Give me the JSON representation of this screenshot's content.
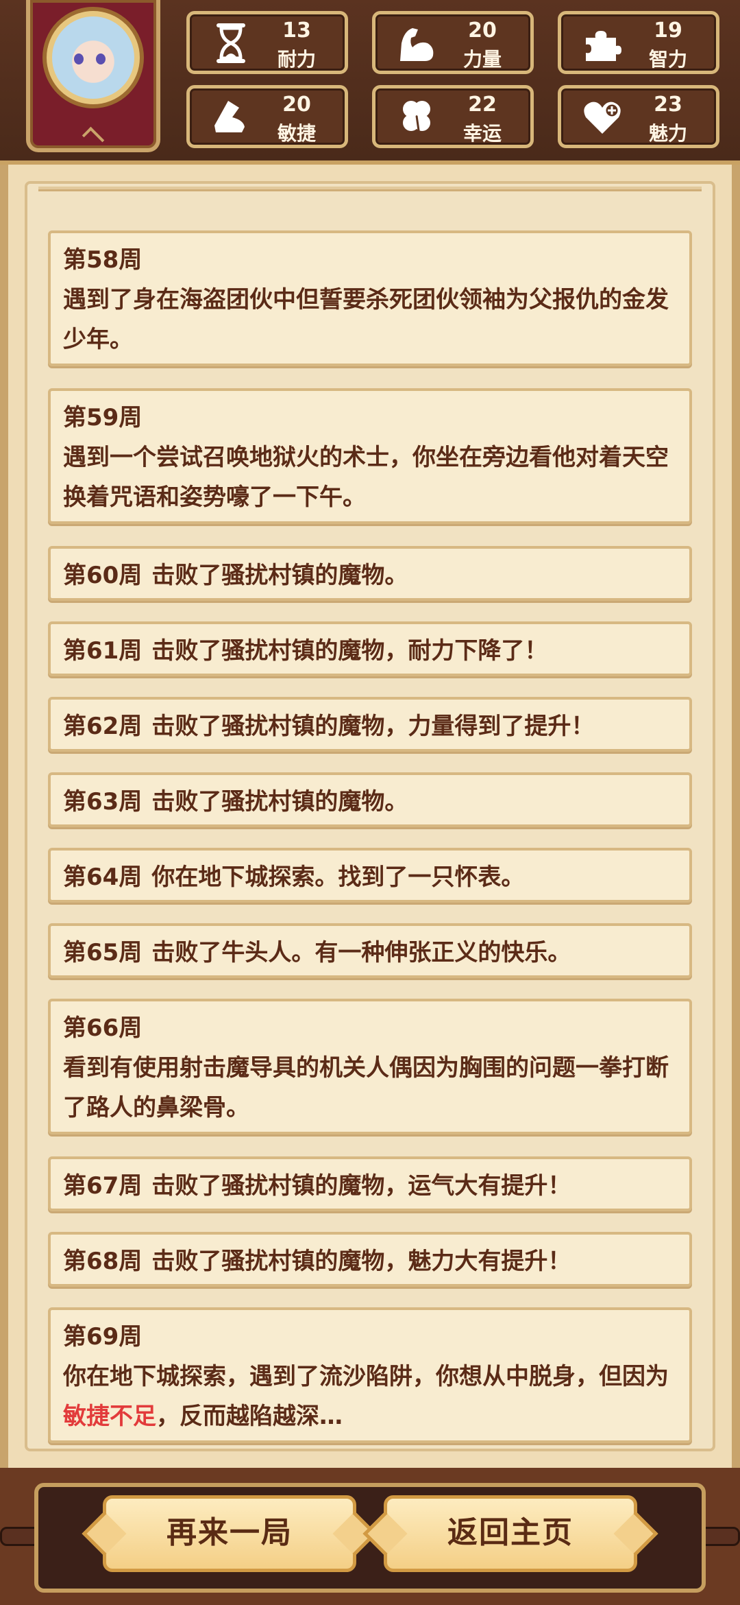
{
  "stats": [
    {
      "value": "13",
      "label": "耐力",
      "icon": "hourglass-icon"
    },
    {
      "value": "20",
      "label": "力量",
      "icon": "muscle-arm-icon"
    },
    {
      "value": "19",
      "label": "智力",
      "icon": "puzzle-icon"
    },
    {
      "value": "20",
      "label": "敏捷",
      "icon": "boot-icon"
    },
    {
      "value": "22",
      "label": "幸运",
      "icon": "clover-icon"
    },
    {
      "value": "23",
      "label": "魅力",
      "icon": "heart-plus-icon"
    }
  ],
  "entries": [
    {
      "week": "第58周",
      "text": "遇到了身在海盗团伙中但誓要杀死团伙领袖为父报仇的金发少年。"
    },
    {
      "week": "第59周",
      "text": "遇到一个尝试召唤地狱火的术士，你坐在旁边看他对着天空换着咒语和姿势嚎了一下午。"
    },
    {
      "week": "第60周",
      "text": "击败了骚扰村镇的魔物。"
    },
    {
      "week": "第61周",
      "text": "击败了骚扰村镇的魔物，耐力下降了！"
    },
    {
      "week": "第62周",
      "text": "击败了骚扰村镇的魔物，力量得到了提升！"
    },
    {
      "week": "第63周",
      "text": "击败了骚扰村镇的魔物。"
    },
    {
      "week": "第64周",
      "text": "你在地下城探索。找到了一只怀表。"
    },
    {
      "week": "第65周",
      "text": "击败了牛头人。有一种伸张正义的快乐。"
    },
    {
      "week": "第66周",
      "text": "看到有使用射击魔导具的机关人偶因为胸围的问题一拳打断了路人的鼻梁骨。"
    },
    {
      "week": "第67周",
      "text": "击败了骚扰村镇的魔物，运气大有提升！"
    },
    {
      "week": "第68周",
      "text": "击败了骚扰村镇的魔物，魅力大有提升！"
    },
    {
      "week": "第69周",
      "text_before": "你在地下城探索，遇到了流沙陷阱，你想从中脱身，但因为",
      "text_highlight": "敏捷不足",
      "text_after": "，反而越陷越深…",
      "highlight_color": "#e23b3b"
    }
  ],
  "buttons": {
    "restart": "再来一局",
    "home": "返回主页"
  }
}
